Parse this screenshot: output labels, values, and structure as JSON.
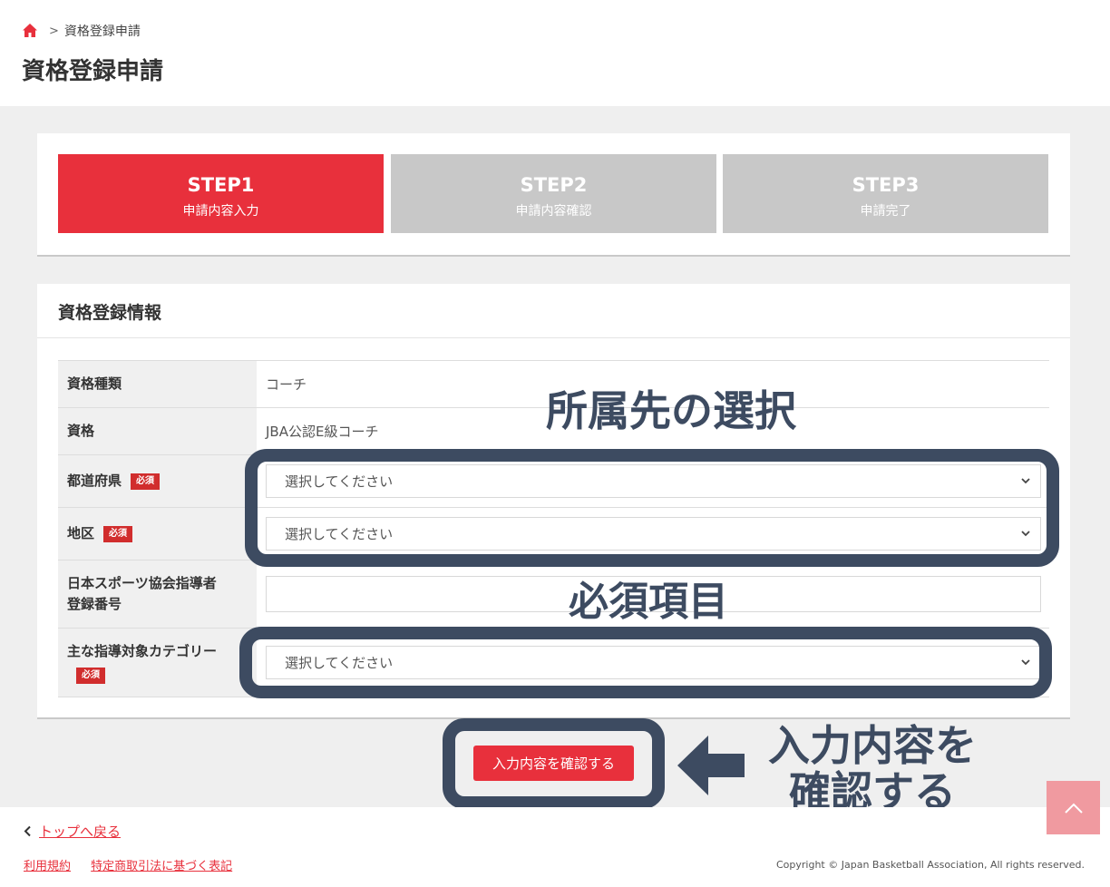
{
  "breadcrumb": {
    "current": "資格登録申請",
    "separator": ">"
  },
  "page_title": "資格登録申請",
  "steps": [
    {
      "title": "STEP1",
      "subtitle": "申請内容入力",
      "active": true
    },
    {
      "title": "STEP2",
      "subtitle": "申請内容確認",
      "active": false
    },
    {
      "title": "STEP3",
      "subtitle": "申請完了",
      "active": false
    }
  ],
  "form": {
    "heading": "資格登録情報",
    "required_badge": "必須",
    "rows": {
      "qualification_type": {
        "label": "資格種類",
        "value": "コーチ"
      },
      "qualification": {
        "label": "資格",
        "value": "JBA公認E級コーチ"
      },
      "prefecture": {
        "label": "都道府県",
        "value": "選択してください"
      },
      "district": {
        "label": "地区",
        "value": "選択してください"
      },
      "sports_assoc_number": {
        "label_line1": "日本スポーツ協会指導者",
        "label_line2": "登録番号",
        "value": ""
      },
      "main_category": {
        "label": "主な指導対象カテゴリー",
        "value": "選択してください"
      }
    }
  },
  "annotations": {
    "affiliation": "所属先の選択",
    "required_items": "必須項目",
    "confirm_line1": "入力内容を",
    "confirm_line2": "確認する"
  },
  "confirm_button": "入力内容を確認する",
  "footer": {
    "back_link": "トップへ戻る",
    "terms": "利用規約",
    "commerce_law": "特定商取引法に基づく表記",
    "copyright": "Copyright © Japan Basketball Association, All rights reserved."
  },
  "colors": {
    "accent": "#e8303c",
    "inactive_step": "#c8c8c8",
    "annotation": "#3d4b61",
    "to_top": "#f09aa0"
  }
}
